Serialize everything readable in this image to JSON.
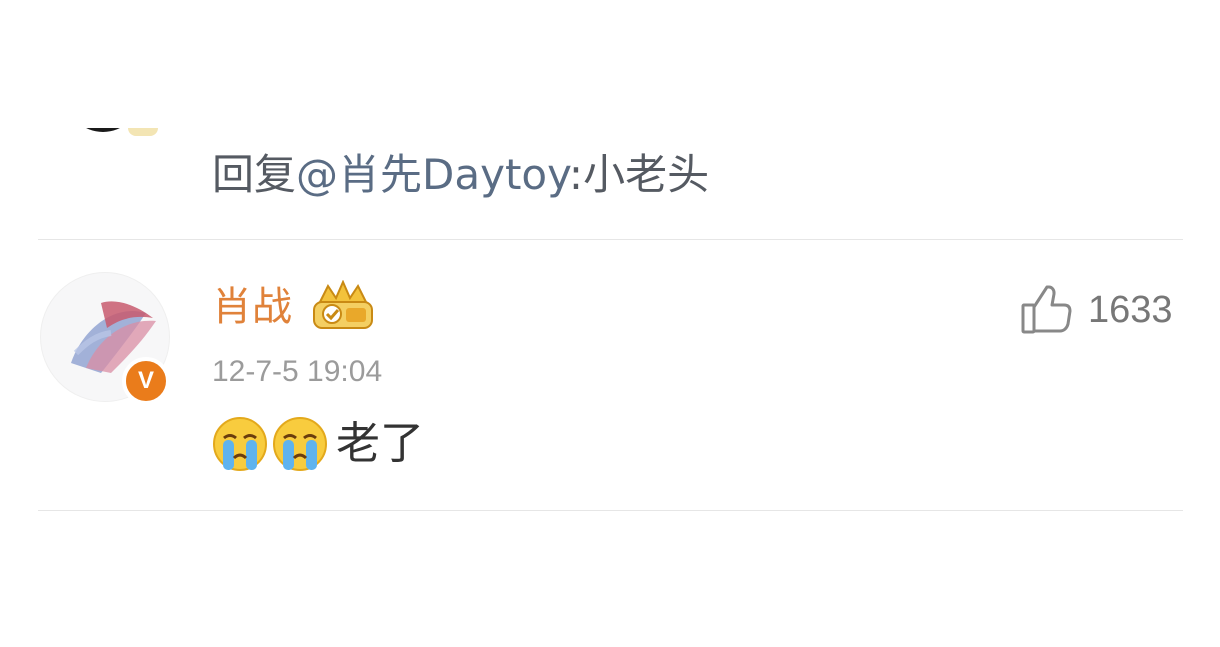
{
  "previous_comment": {
    "reply_prefix": "回复",
    "mention": "@肖先Daytoy",
    "reply_text": ":小老头"
  },
  "comment": {
    "username": "肖战",
    "verified_badge": "V",
    "crown_icon": "gold-crown-badge-icon",
    "timestamp": "12-7-5 19:04",
    "like_count": "1633",
    "emojis": [
      "crying-face-icon",
      "crying-face-icon"
    ],
    "text": "老了"
  },
  "colors": {
    "username": "#e0823a",
    "mention": "#5a6c84",
    "verified_badge": "#ea7c1b",
    "timestamp": "#9b9b9b"
  }
}
